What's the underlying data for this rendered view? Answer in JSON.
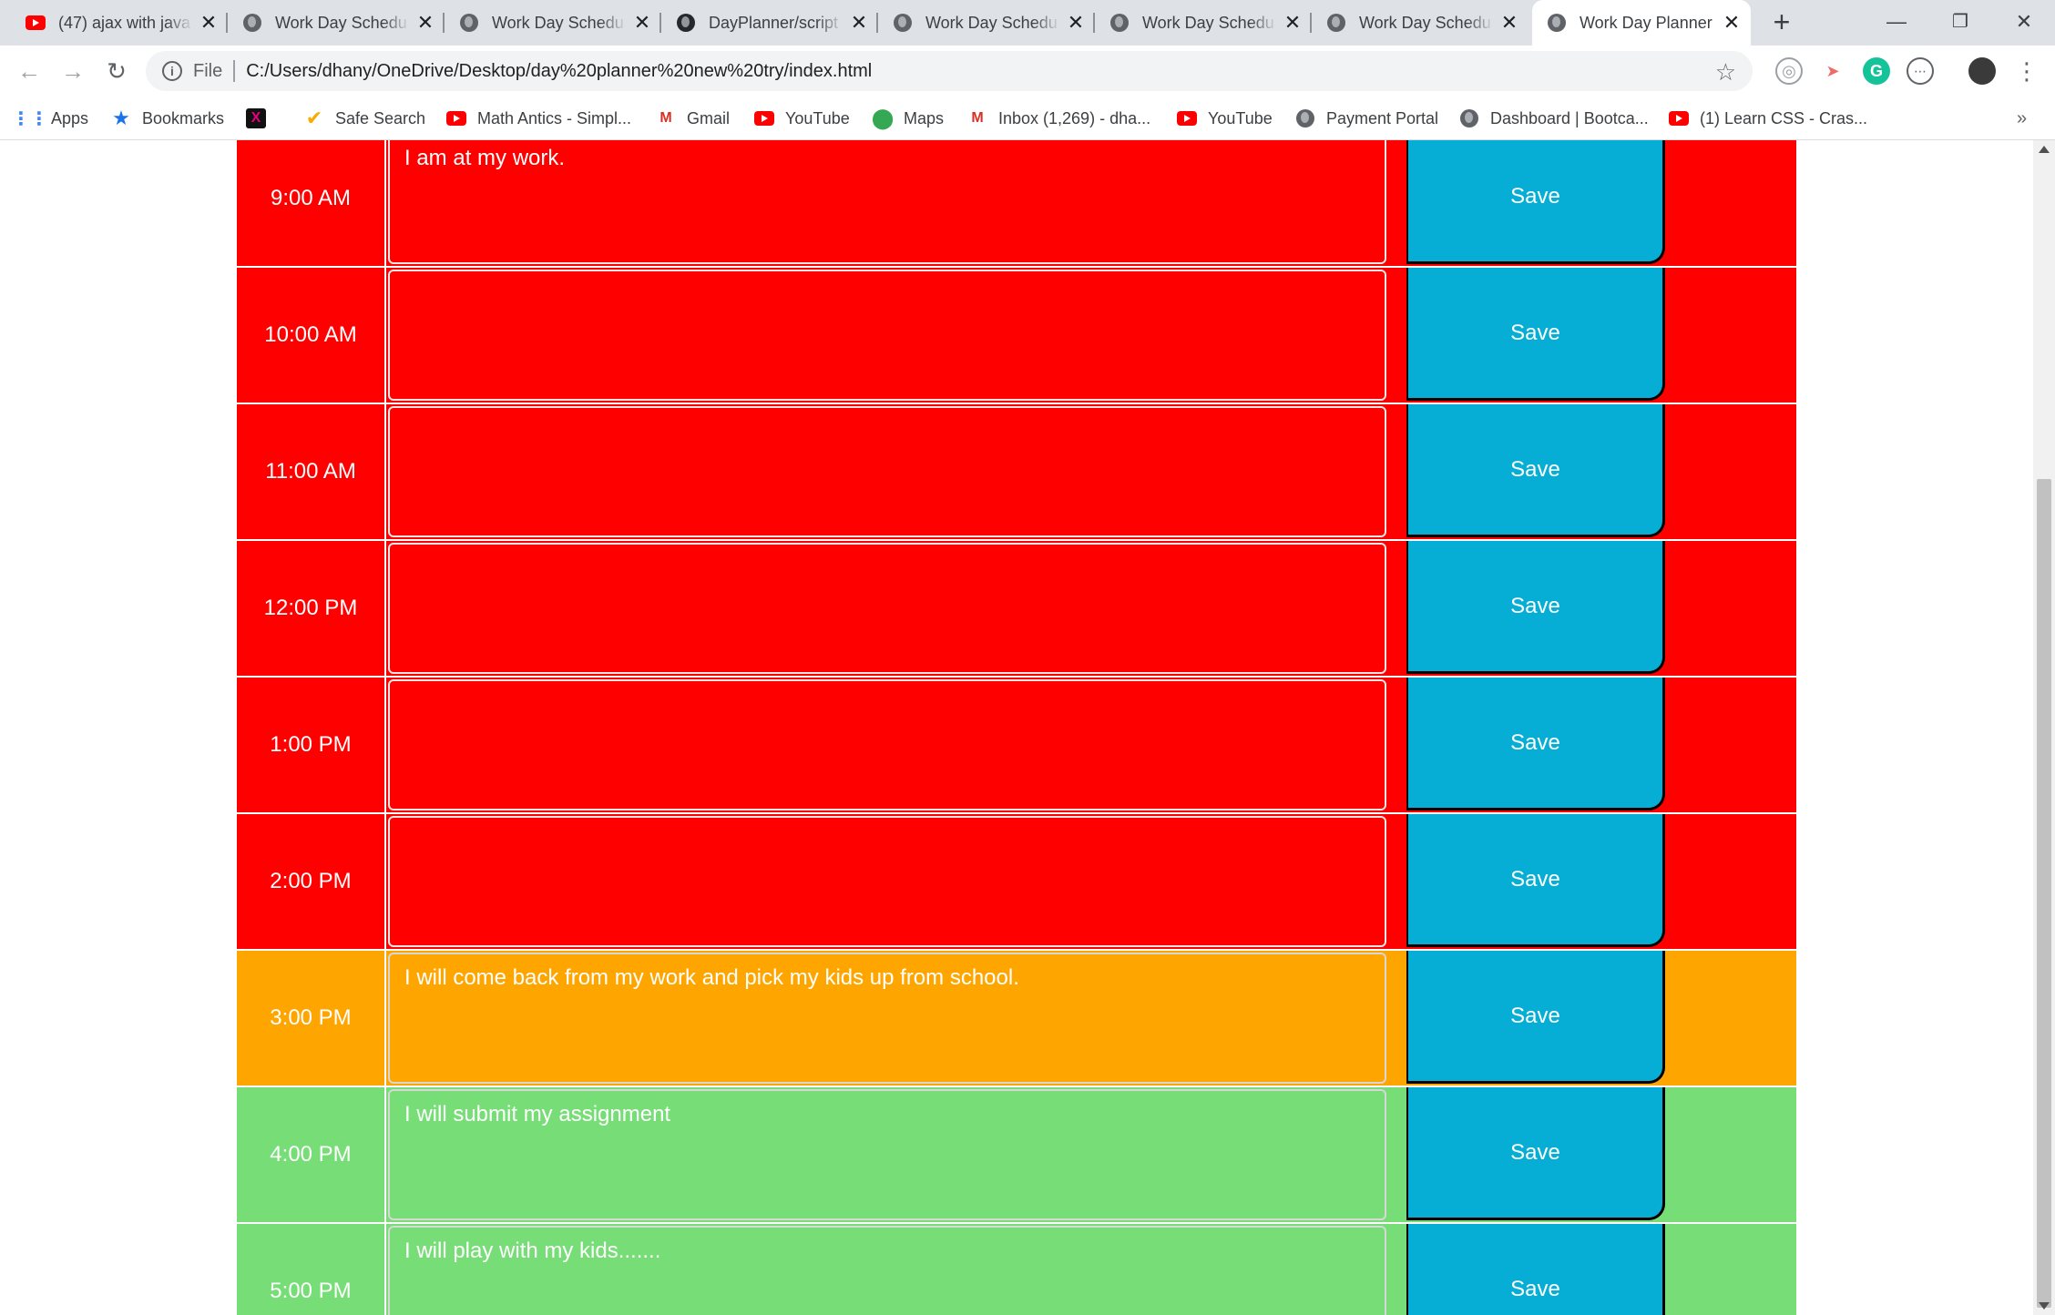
{
  "browser": {
    "tabs": [
      {
        "title": "(47) ajax with java",
        "icon": "youtube-icon",
        "active": false
      },
      {
        "title": "Work Day Schedu",
        "icon": "globe-icon",
        "active": false
      },
      {
        "title": "Work Day Schedu",
        "icon": "globe-icon",
        "active": false
      },
      {
        "title": "DayPlanner/script",
        "icon": "github-icon",
        "active": false
      },
      {
        "title": "Work Day Schedu",
        "icon": "globe-icon",
        "active": false
      },
      {
        "title": "Work Day Schedu",
        "icon": "globe-icon",
        "active": false
      },
      {
        "title": "Work Day Schedu",
        "icon": "globe-icon",
        "active": false
      },
      {
        "title": "Work Day Planner",
        "icon": "globe-icon",
        "active": true
      }
    ],
    "address": {
      "scheme_label": "File",
      "url": "C:/Users/dhany/OneDrive/Desktop/day%20planner%20new%20try/index.html"
    },
    "bookmarks": [
      {
        "label": "Apps",
        "icon": "apps-grid-icon"
      },
      {
        "label": "Bookmarks",
        "icon": "star-icon"
      },
      {
        "label": "",
        "icon": "x-logo-icon"
      },
      {
        "label": "Safe Search",
        "icon": "safe-search-icon"
      },
      {
        "label": "Math Antics - Simpl...",
        "icon": "youtube-icon"
      },
      {
        "label": "Gmail",
        "icon": "gmail-icon"
      },
      {
        "label": "YouTube",
        "icon": "youtube-icon"
      },
      {
        "label": "Maps",
        "icon": "maps-icon"
      },
      {
        "label": "Inbox (1,269) - dha...",
        "icon": "gmail-icon"
      },
      {
        "label": "YouTube",
        "icon": "youtube-icon"
      },
      {
        "label": "Payment Portal",
        "icon": "globe-icon"
      },
      {
        "label": "Dashboard | Bootca...",
        "icon": "globe-icon"
      },
      {
        "label": "(1) Learn CSS - Cras...",
        "icon": "youtube-icon"
      }
    ]
  },
  "colors": {
    "past": "#ff0000",
    "present": "#ffa500",
    "future": "#77dd77",
    "save_button": "#06aed5"
  },
  "planner": {
    "save_label": "Save",
    "rows": [
      {
        "hour": "9:00 AM",
        "state": "past",
        "text": "I am at my work."
      },
      {
        "hour": "10:00 AM",
        "state": "past",
        "text": ""
      },
      {
        "hour": "11:00 AM",
        "state": "past",
        "text": ""
      },
      {
        "hour": "12:00 PM",
        "state": "past",
        "text": ""
      },
      {
        "hour": "1:00 PM",
        "state": "past",
        "text": ""
      },
      {
        "hour": "2:00 PM",
        "state": "past",
        "text": ""
      },
      {
        "hour": "3:00 PM",
        "state": "present",
        "text": "I will come back from my work and pick my kids up from school."
      },
      {
        "hour": "4:00 PM",
        "state": "future",
        "text": "I will submit my assignment"
      },
      {
        "hour": "5:00 PM",
        "state": "future",
        "text": "I will play with my kids......."
      }
    ]
  }
}
